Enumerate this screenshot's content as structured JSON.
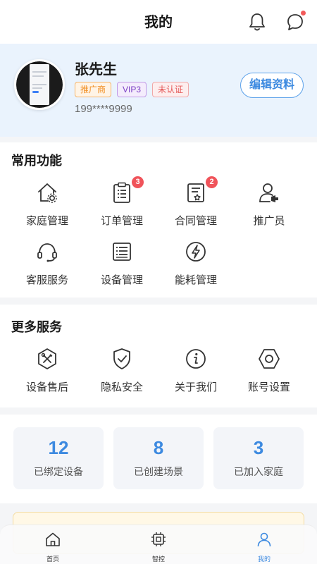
{
  "header": {
    "title": "我的",
    "notification_icon": "bell-icon",
    "message_icon": "chat-bubble-icon"
  },
  "profile": {
    "name": "张先生",
    "tags": [
      "推广商",
      "VIP3",
      "未认证"
    ],
    "phone": "199****9999",
    "edit_label": "编辑资料"
  },
  "common_functions": {
    "title": "常用功能",
    "items": [
      {
        "label": "家庭管理",
        "icon": "home-gear-icon"
      },
      {
        "label": "订单管理",
        "icon": "order-list-icon",
        "badge": "3"
      },
      {
        "label": "合同管理",
        "icon": "contract-icon",
        "badge": "2"
      },
      {
        "label": "推广员",
        "icon": "promoter-icon"
      },
      {
        "label": "客服服务",
        "icon": "headset-icon"
      },
      {
        "label": "设备管理",
        "icon": "device-list-icon"
      },
      {
        "label": "能耗管理",
        "icon": "lightning-icon"
      }
    ]
  },
  "more_services": {
    "title": "更多服务",
    "items": [
      {
        "label": "设备售后",
        "icon": "tools-icon"
      },
      {
        "label": "隐私安全",
        "icon": "shield-check-icon"
      },
      {
        "label": "关于我们",
        "icon": "info-icon"
      },
      {
        "label": "账号设置",
        "icon": "settings-hex-icon"
      }
    ]
  },
  "stats": [
    {
      "value": "12",
      "label": "已绑定设备"
    },
    {
      "value": "8",
      "label": "已创建场景"
    },
    {
      "value": "3",
      "label": "已加入家庭"
    }
  ],
  "tabbar": {
    "items": [
      {
        "label": "首页",
        "icon": "home-icon"
      },
      {
        "label": "智控",
        "icon": "chip-icon"
      },
      {
        "label": "我的",
        "icon": "user-icon"
      }
    ],
    "active": "我的"
  },
  "colors": {
    "accent": "#3d8ae0",
    "badge": "#f0535a",
    "profile_bg": "#eaf3fd"
  }
}
